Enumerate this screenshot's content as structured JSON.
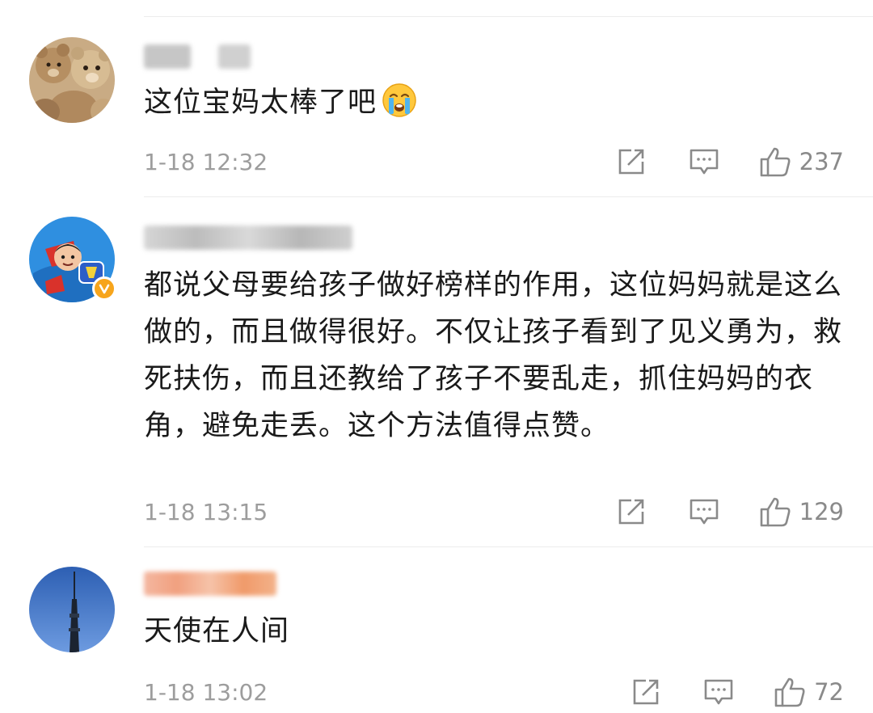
{
  "comments": [
    {
      "text": "这位宝妈太棒了吧",
      "emoji": "crying-face-emoji",
      "time": "1-18 12:32",
      "likes": "237",
      "avatar": "teddy-bears-avatar",
      "verified": false
    },
    {
      "text": "都说父母要给孩子做好榜样的作用，这位妈妈就是这么做的，而且做得很好。不仅让孩子看到了见义勇为，救死扶伤，而且还教给了孩子不要乱走，抓住妈妈的衣角，避免走丢。这个方法值得点赞。",
      "time": "1-18 13:15",
      "likes": "129",
      "avatar": "superhero-cartoon-avatar",
      "verified": true
    },
    {
      "text": "天使在人间",
      "time": "1-18 13:02",
      "likes": "72",
      "avatar": "tower-sky-avatar",
      "verified": false
    }
  ],
  "colors": {
    "text": "#1a1a1a",
    "meta": "#9d9d9d",
    "icon": "#8a8a8a",
    "verified_badge": "#f7a51c",
    "divider": "#ececec"
  }
}
